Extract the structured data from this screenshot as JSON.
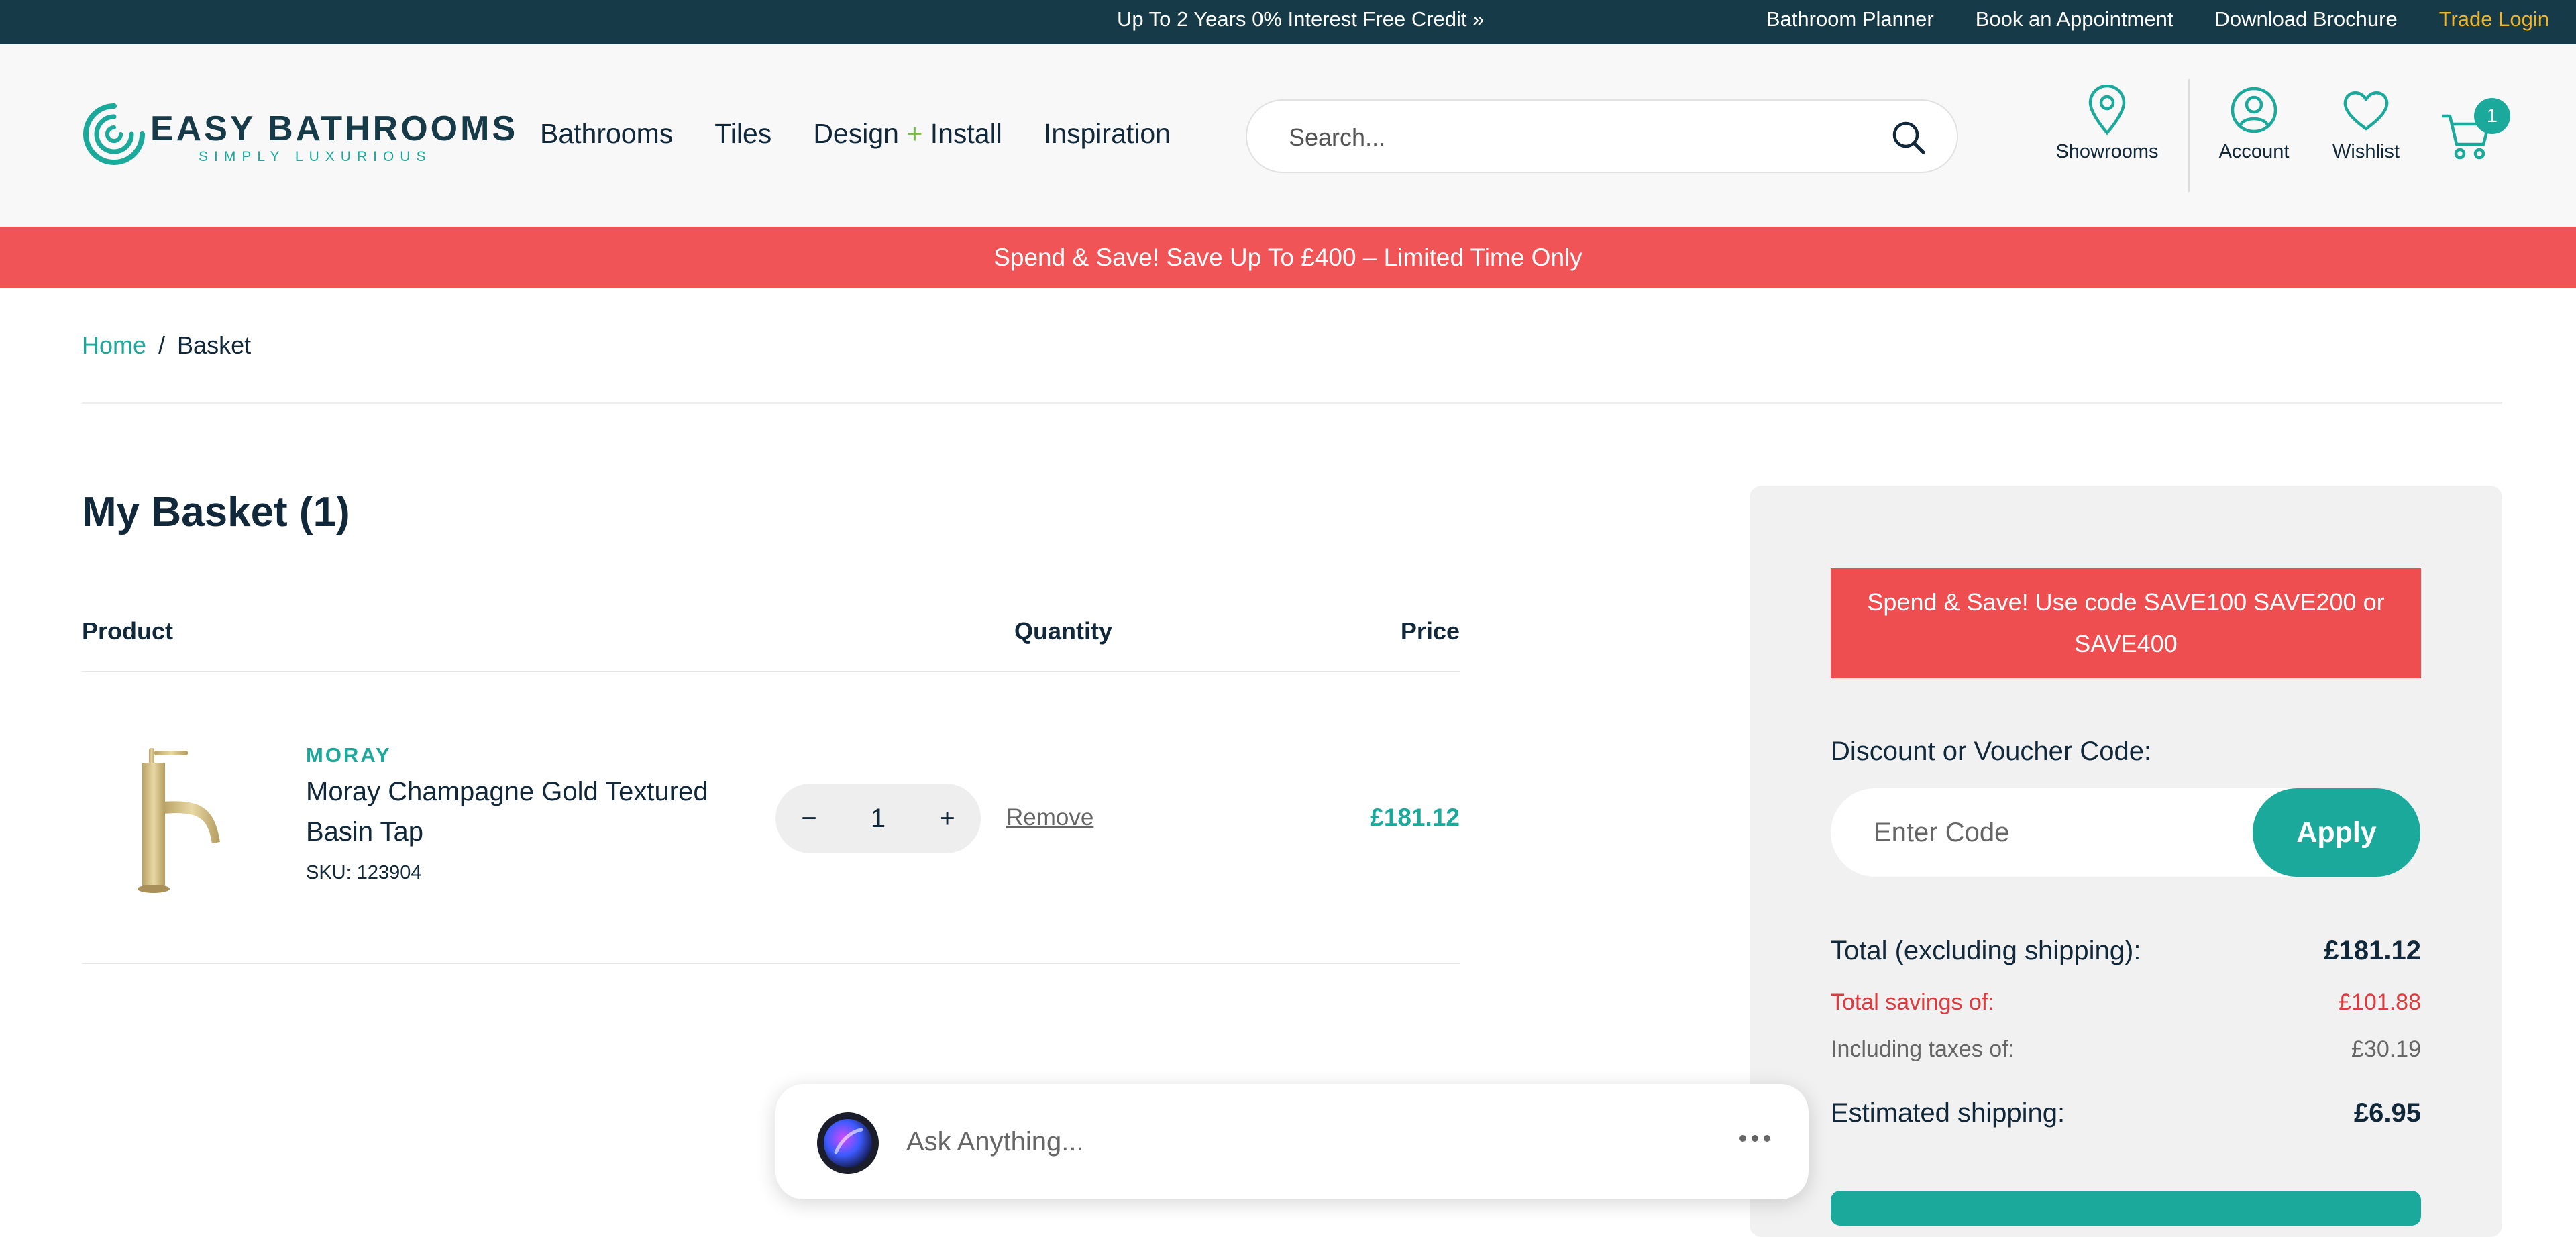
{
  "topbar": {
    "promo": "Up To 2 Years 0% Interest Free Credit »",
    "links": [
      "Bathroom Planner",
      "Book an Appointment",
      "Download Brochure"
    ],
    "trade_login": "Trade Login"
  },
  "header": {
    "logo_title": "EASY BATHROOMS",
    "logo_subtitle": "SIMPLY LUXURIOUS",
    "nav": {
      "bathrooms": "Bathrooms",
      "tiles": "Tiles",
      "design_a": "Design",
      "design_plus": "+",
      "design_b": "Install",
      "inspiration": "Inspiration"
    },
    "search_placeholder": "Search...",
    "showrooms": "Showrooms",
    "account": "Account",
    "wishlist": "Wishlist",
    "cart_count": "1",
    "icons": [
      "location-pin-icon",
      "account-icon",
      "heart-icon",
      "cart-icon",
      "search-icon"
    ]
  },
  "banner": "Spend & Save! Save Up To £400 – Limited Time Only",
  "breadcrumb": {
    "home": "Home",
    "sep": "/",
    "current": "Basket"
  },
  "basket": {
    "title": "My Basket (1)",
    "columns": {
      "product": "Product",
      "quantity": "Quantity",
      "price": "Price"
    },
    "items": [
      {
        "brand": "MORAY",
        "name": "Moray Champagne Gold Textured Basin Tap",
        "sku": "SKU: 123904",
        "quantity": "1",
        "minus": "−",
        "plus": "+",
        "remove": "Remove",
        "price": "£181.12"
      }
    ]
  },
  "summary": {
    "promo": "Spend & Save! Use code SAVE100 SAVE200 or SAVE400",
    "voucher_label": "Discount or Voucher Code:",
    "voucher_placeholder": "Enter Code",
    "apply": "Apply",
    "total_label": "Total (excluding shipping):",
    "total_value": "£181.12",
    "savings_label": "Total savings of:",
    "savings_value": "£101.88",
    "taxes_label": "Including taxes of:",
    "taxes_value": "£30.19",
    "shipping_label": "Estimated shipping:",
    "shipping_value": "£6.95"
  },
  "chat": {
    "placeholder": "Ask Anything..."
  },
  "colors": {
    "teal": "#1aa99b",
    "navy": "#163a47",
    "promo_red": "#f05456",
    "gold": "#f0b429"
  }
}
